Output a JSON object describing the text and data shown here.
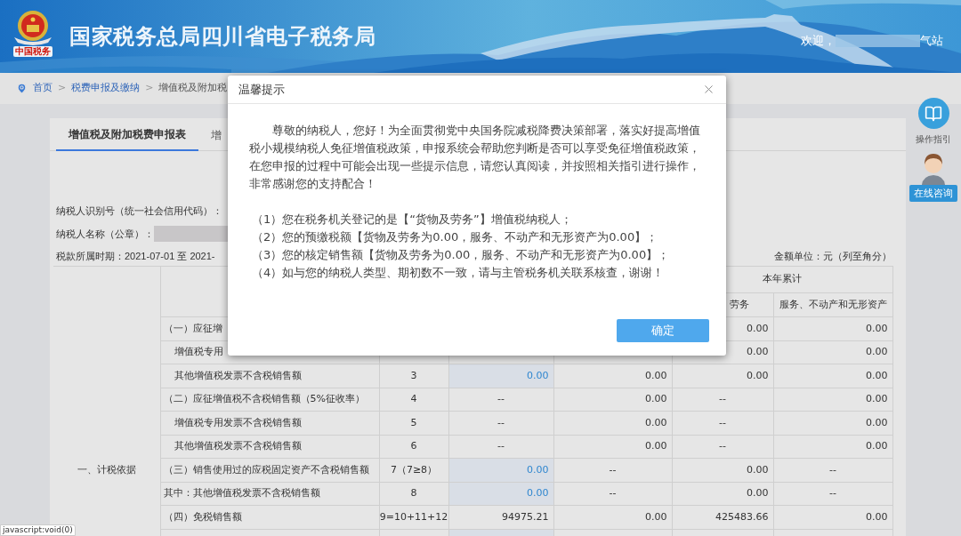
{
  "header": {
    "logo_caption": "中国税务",
    "title": "国家税务总局四川省电子税务局",
    "welcome_prefix": "欢迎，",
    "welcome_suffix": "气站"
  },
  "breadcrumb": {
    "separator": ">",
    "items": [
      {
        "text": "首页",
        "link": true
      },
      {
        "text": "税费申报及缴纳",
        "link": true
      },
      {
        "text": "增值税及附加税",
        "link": false
      }
    ]
  },
  "tabs": [
    {
      "label": "增值税及附加税费申报表",
      "selected": true
    },
    {
      "label": "增",
      "selected": false
    }
  ],
  "info": {
    "taxpayer_id_label": "纳税人识别号（统一社会信用代码）：",
    "taxpayer_name_label": "纳税人名称（公章）：",
    "period": "税款所属时期：2021-07-01 至 2021-",
    "unit": "金额单位：元（列至角分）"
  },
  "table": {
    "group_header": "本年累计",
    "subheaders": [
      "劳务",
      "服务、不动产和无形资产"
    ],
    "section_label": "一、计税依据",
    "rows": [
      {
        "item": "（一）应征增",
        "sub": false,
        "section": false,
        "cells": [
          {
            "text": "0.00",
            "kind": "amount",
            "editable": false
          },
          {
            "text": "0.00",
            "kind": "amount",
            "editable": false
          }
        ]
      },
      {
        "item": "增值税专用",
        "sub": true,
        "section": false,
        "cells": [
          {
            "text": "0.00",
            "kind": "amount",
            "editable": false
          },
          {
            "text": "0.00",
            "kind": "amount",
            "editable": false
          }
        ]
      },
      {
        "item": "其他增值税发票不含税销售额",
        "sub": true,
        "section": false,
        "line": "3",
        "cells": [
          {
            "text": "0.00",
            "kind": "amount",
            "editable": true
          },
          {
            "text": "0.00",
            "kind": "amount",
            "editable": false
          },
          {
            "text": "0.00",
            "kind": "amount",
            "editable": false
          },
          {
            "text": "0.00",
            "kind": "amount",
            "editable": false
          }
        ]
      },
      {
        "item": "（二）应征增值税不含税销售额（5%征收率）",
        "sub": false,
        "section": false,
        "line": "4",
        "cells": [
          {
            "text": "--",
            "kind": "blank",
            "editable": false
          },
          {
            "text": "0.00",
            "kind": "amount",
            "editable": false
          },
          {
            "text": "--",
            "kind": "blank",
            "editable": false
          },
          {
            "text": "0.00",
            "kind": "amount",
            "editable": false
          }
        ]
      },
      {
        "item": "增值税专用发票不含税销售额",
        "sub": true,
        "section": false,
        "line": "5",
        "cells": [
          {
            "text": "--",
            "kind": "blank",
            "editable": false
          },
          {
            "text": "0.00",
            "kind": "amount",
            "editable": false
          },
          {
            "text": "--",
            "kind": "blank",
            "editable": false
          },
          {
            "text": "0.00",
            "kind": "amount",
            "editable": false
          }
        ]
      },
      {
        "item": "其他增值税发票不含税销售额",
        "sub": true,
        "section": false,
        "line": "6",
        "cells": [
          {
            "text": "--",
            "kind": "blank",
            "editable": false
          },
          {
            "text": "0.00",
            "kind": "amount",
            "editable": false
          },
          {
            "text": "--",
            "kind": "blank",
            "editable": false
          },
          {
            "text": "0.00",
            "kind": "amount",
            "editable": false
          }
        ]
      },
      {
        "item": "（三）销售使用过的应税固定资产不含税销售额",
        "sub": false,
        "section": true,
        "line": "7（7≥8）",
        "cells": [
          {
            "text": "0.00",
            "kind": "amount",
            "editable": true
          },
          {
            "text": "--",
            "kind": "blank",
            "editable": false
          },
          {
            "text": "0.00",
            "kind": "amount",
            "editable": false
          },
          {
            "text": "--",
            "kind": "blank",
            "editable": false
          }
        ]
      },
      {
        "item": "其中：其他增值税发票不含税销售额",
        "sub": false,
        "section": false,
        "line": "8",
        "cells": [
          {
            "text": "0.00",
            "kind": "amount",
            "editable": true
          },
          {
            "text": "--",
            "kind": "blank",
            "editable": false
          },
          {
            "text": "0.00",
            "kind": "amount",
            "editable": false
          },
          {
            "text": "--",
            "kind": "blank",
            "editable": false
          }
        ]
      },
      {
        "item": "（四）免税销售额",
        "sub": false,
        "section": false,
        "line": "9=10+11+12",
        "cells": [
          {
            "text": "94975.21",
            "kind": "amount",
            "editable": false
          },
          {
            "text": "0.00",
            "kind": "amount",
            "editable": false
          },
          {
            "text": "425483.66",
            "kind": "amount",
            "editable": false
          },
          {
            "text": "0.00",
            "kind": "amount",
            "editable": false
          }
        ]
      }
    ]
  },
  "side": {
    "guide": "操作指引",
    "consult": "在线咨询"
  },
  "dialog": {
    "title": "温馨提示",
    "paragraph": "尊敬的纳税人，您好！为全面贯彻党中央国务院减税降费决策部署，落实好提高增值税小规模纳税人免征增值税政策，申报系统会帮助您判断是否可以享受免征增值税政策，在您申报的过程中可能会出现一些提示信息，请您认真阅读，并按照相关指引进行操作，非常感谢您的支持配合！",
    "items": [
      "（1）您在税务机关登记的是【“货物及劳务”】增值税纳税人；",
      "（2）您的预缴税额【货物及劳务为0.00，服务、不动产和无形资产为0.00】；",
      "（3）您的核定销售额【货物及劳务为0.00，服务、不动产和无形资产为0.00】；",
      "（4）如与您的纳税人类型、期初数不一致，请与主管税务机关联系核查，谢谢！"
    ],
    "button": "确定"
  },
  "status_link": "javascript:void(0)"
}
